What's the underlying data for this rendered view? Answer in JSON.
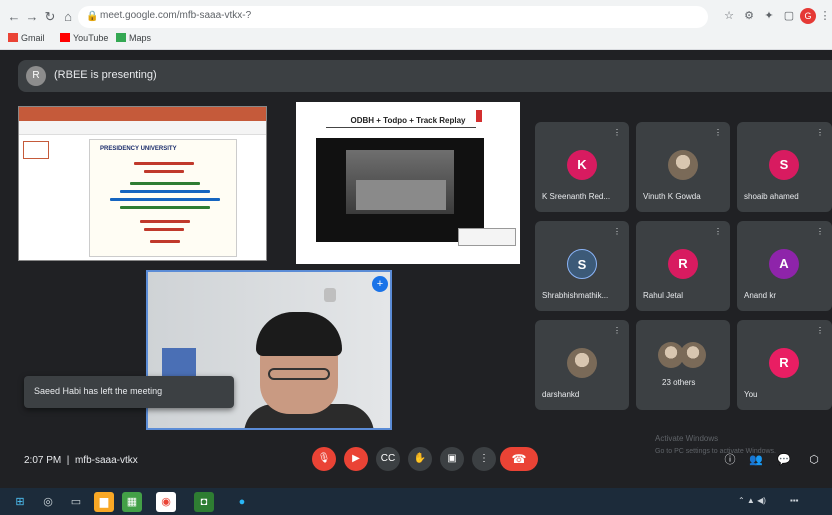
{
  "browser": {
    "url": "meet.google.com/mfb-saaa-vtkx-?",
    "bookmarks": [
      "Gmail",
      "YouTube",
      "Maps"
    ],
    "profile_initial": "G"
  },
  "meet": {
    "presenting_label": "(RBEE is presenting)",
    "presenter_initial": "R",
    "slide1": {
      "university": "PRESIDENCY UNIVERSITY"
    },
    "slide2": {
      "title": "ODBH + Todpo + Track Replay"
    },
    "toast": "Saeed Habi has left the meeting",
    "participants": [
      {
        "name": "K Sreenanth Red...",
        "initial": "K",
        "color": "#d81b60",
        "photo": false
      },
      {
        "name": "Vinuth K Gowda",
        "initial": "",
        "color": "",
        "photo": true
      },
      {
        "name": "shoaib ahamed",
        "initial": "S",
        "color": "#d81b60",
        "photo": false
      },
      {
        "name": "Shrabhishmathik...",
        "initial": "S",
        "color": "#3c5a78",
        "photo": false
      },
      {
        "name": "Rahul Jetal",
        "initial": "R",
        "color": "#d81b60",
        "photo": false
      },
      {
        "name": "Anand kr",
        "initial": "A",
        "color": "#8e24aa",
        "photo": false
      },
      {
        "name": "darshankd",
        "initial": "",
        "color": "",
        "photo": true
      },
      {
        "name": "23 others",
        "initial": "",
        "color": "",
        "photo": true
      },
      {
        "name": "You",
        "initial": "R",
        "color": "#e91e63",
        "photo": false
      }
    ],
    "clock": "2:07 PM",
    "meeting_code": "mfb-saaa-vtkx",
    "watermark_line1": "Activate Windows",
    "watermark_line2": "Go to PC settings to activate Windows."
  },
  "colors": {
    "meet_bg": "#202124",
    "end_call": "#ea4335",
    "accent": "#1a73e8"
  }
}
